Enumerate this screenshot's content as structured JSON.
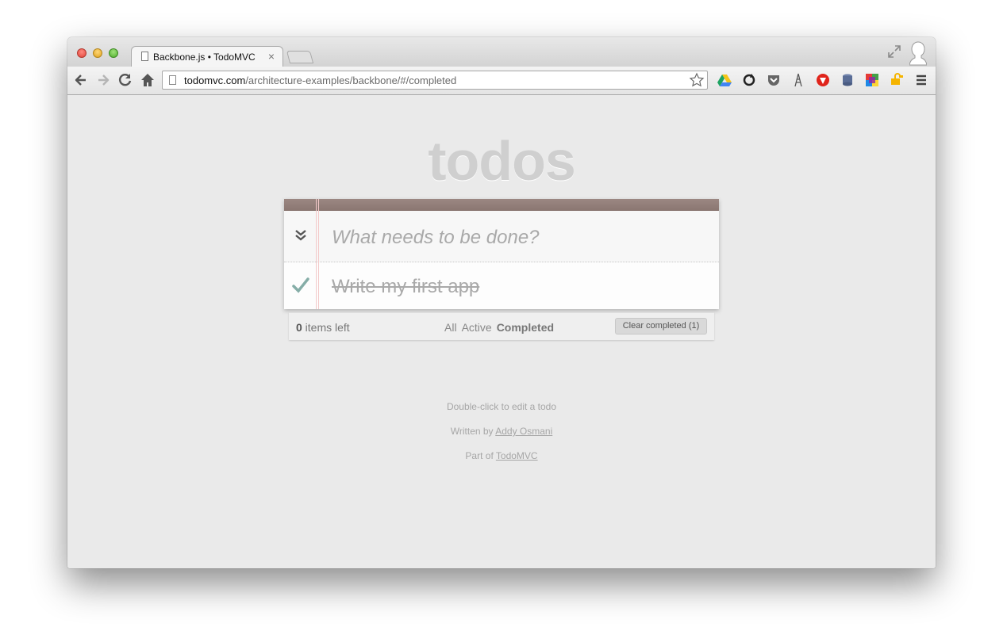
{
  "browser": {
    "tab": {
      "title": "Backbone.js • TodoMVC",
      "close": "×"
    },
    "address": {
      "host": "todomvc.com",
      "path": "/architecture-examples/backbone/#/completed"
    }
  },
  "app": {
    "title": "todos",
    "new_todo_placeholder": "What needs to be done?",
    "todos": [
      {
        "title": "Write my first app",
        "completed": true
      }
    ],
    "footer": {
      "count": "0",
      "count_suffix": " items left",
      "filters": [
        "All",
        "Active",
        "Completed"
      ],
      "selected_filter": "Completed",
      "clear_label": "Clear completed (1)"
    },
    "info": {
      "edit_hint": "Double-click to edit a todo",
      "written_by": "Written by ",
      "author": "Addy Osmani",
      "part_of": "Part of ",
      "project": "TodoMVC"
    }
  },
  "colors": {
    "header_bar": "#8e7a75",
    "check": "#85ada7",
    "title": "#cfcfcf"
  },
  "icons": [
    "back-icon",
    "forward-icon",
    "reload-icon",
    "home-icon",
    "star-icon",
    "drive-icon",
    "sync-icon",
    "pocket-icon",
    "tower-icon",
    "opera-icon",
    "database-icon",
    "puzzle-icon",
    "key-icon",
    "menu-icon",
    "toggle-all-icon",
    "check-icon"
  ]
}
